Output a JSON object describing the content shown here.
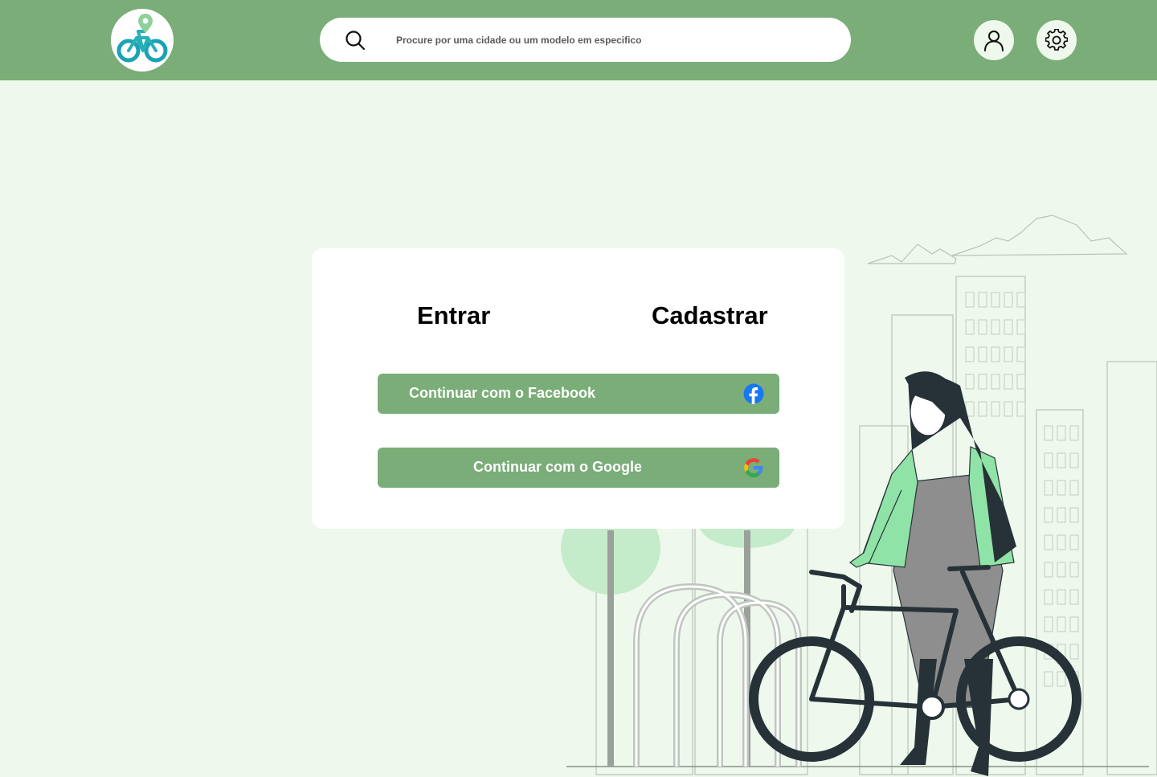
{
  "header": {
    "logo_name": "bike-location-logo",
    "search": {
      "placeholder": "Procure por uma cidade ou um modelo em especifico",
      "value": ""
    },
    "user_icon": "user-icon",
    "settings_icon": "gear-icon"
  },
  "auth_card": {
    "tabs": [
      {
        "label": "Entrar"
      },
      {
        "label": "Cadastrar"
      }
    ],
    "facebook_button": {
      "label": "Continuar com o Facebook",
      "icon": "facebook-icon"
    },
    "google_button": {
      "label": "Continuar com o Google",
      "icon": "google-icon"
    }
  },
  "colors": {
    "header_bg": "#7aad78",
    "page_bg": "#eef8ec",
    "button_bg": "#7aad78",
    "accent_teal": "#1aa3b5",
    "accent_green": "#8ed09a",
    "facebook_blue": "#1877f2"
  }
}
